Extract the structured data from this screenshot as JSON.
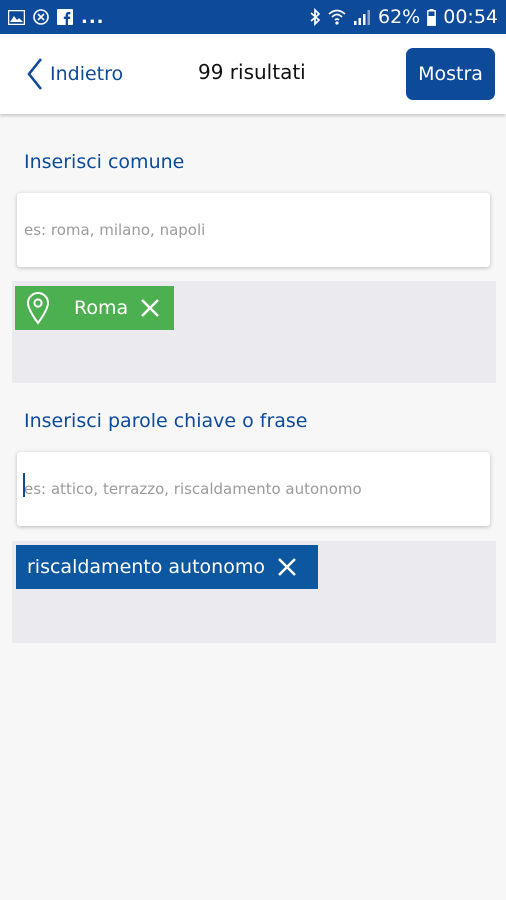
{
  "status_bar": {
    "battery": "62%",
    "time": "00:54",
    "overflow": "..."
  },
  "header": {
    "back_label": "Indietro",
    "results": "99 risultati",
    "show_button": "Mostra"
  },
  "comune": {
    "label": "Inserisci comune",
    "placeholder": "es: roma, milano, napoli",
    "tags": [
      "Roma"
    ]
  },
  "keywords": {
    "label": "Inserisci parole chiave o frase",
    "placeholder": "es: attico, terrazzo, riscaldamento autonomo",
    "tags": [
      "riscaldamento autonomo"
    ]
  },
  "colors": {
    "primary": "#0d4a9a",
    "chip_green": "#4caf50",
    "chip_blue": "#0d57a0"
  }
}
